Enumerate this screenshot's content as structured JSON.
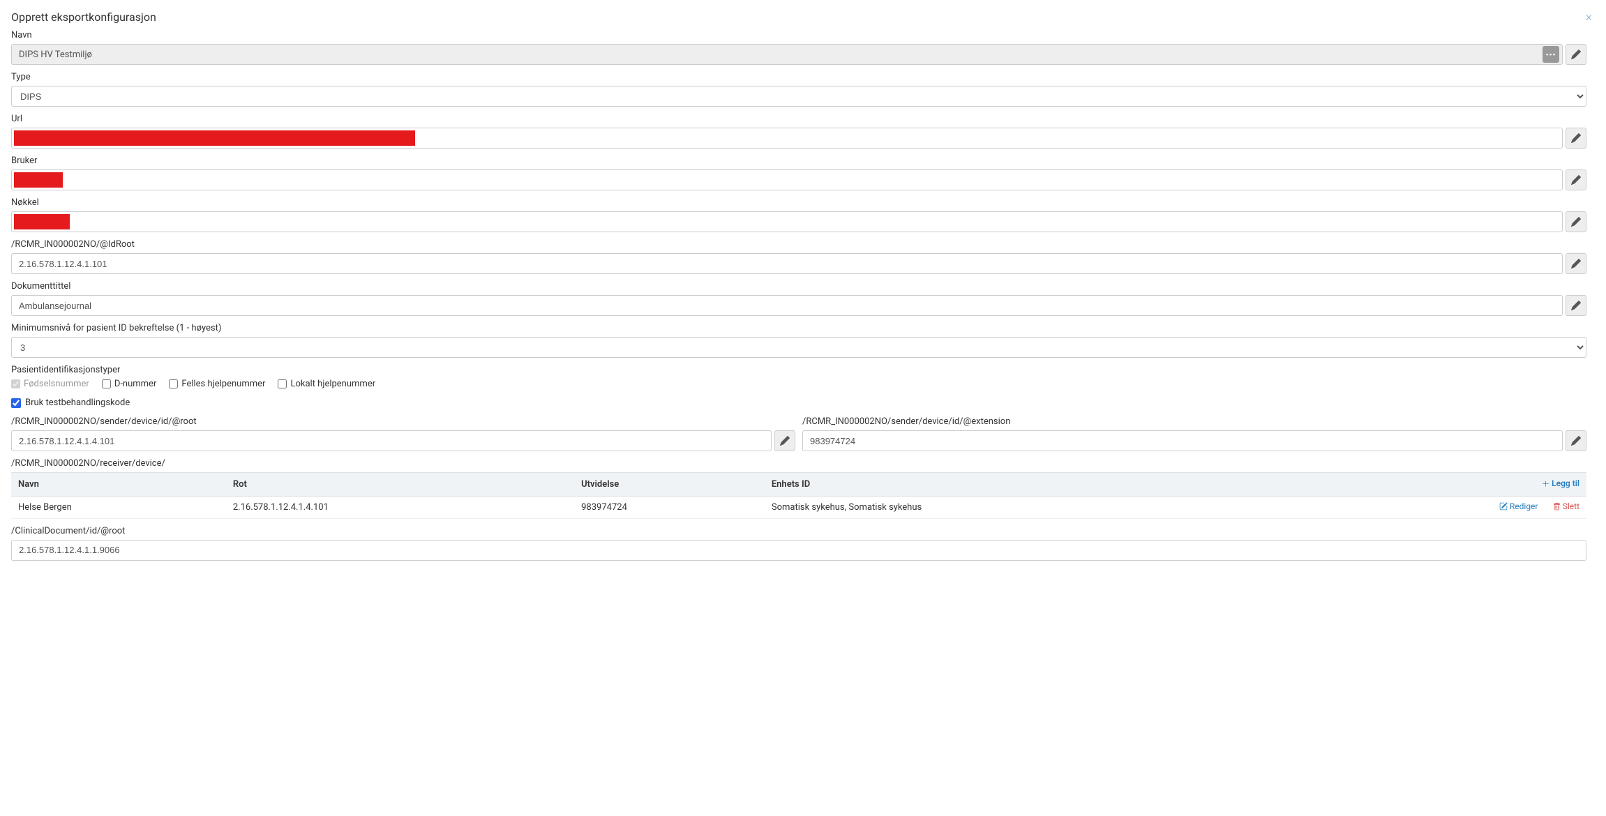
{
  "header": {
    "title": "Opprett eksportkonfigurasjon"
  },
  "fields": {
    "navn": {
      "label": "Navn",
      "value": "DIPS HV Testmiljø"
    },
    "type": {
      "label": "Type",
      "value": "DIPS"
    },
    "url": {
      "label": "Url"
    },
    "bruker": {
      "label": "Bruker"
    },
    "nokkel": {
      "label": "Nøkkel"
    },
    "idRoot": {
      "label": "/RCMR_IN000002NO/@IdRoot",
      "value": "2.16.578.1.12.4.1.101"
    },
    "dokTittel": {
      "label": "Dokumenttittel",
      "value": "Ambulansejournal"
    },
    "minNivaa": {
      "label": "Minimumsnivå for pasient ID bekreftelse (1 - høyest)",
      "value": "3"
    },
    "patientIdTypes": {
      "label": "Pasientidentifikasjonstyper",
      "options": [
        {
          "label": "Fødselsnummer",
          "checked": true,
          "disabled": true
        },
        {
          "label": "D-nummer",
          "checked": false,
          "disabled": false
        },
        {
          "label": "Felles hjelpenummer",
          "checked": false,
          "disabled": false
        },
        {
          "label": "Lokalt hjelpenummer",
          "checked": false,
          "disabled": false
        }
      ]
    },
    "testBehandling": {
      "label": "Bruk testbehandlingskode",
      "checked": true
    },
    "senderRoot": {
      "label": "/RCMR_IN000002NO/sender/device/id/@root",
      "value": "2.16.578.1.12.4.1.4.101"
    },
    "senderExt": {
      "label": "/RCMR_IN000002NO/sender/device/id/@extension",
      "value": "983974724"
    },
    "receiver": {
      "label": "/RCMR_IN000002NO/receiver/device/"
    },
    "clinDocRoot": {
      "label": "/ClinicalDocument/id/@root",
      "value": "2.16.578.1.12.4.1.1.9066"
    }
  },
  "receiverTable": {
    "headers": {
      "navn": "Navn",
      "rot": "Rot",
      "utvidelse": "Utvidelse",
      "enhetsId": "Enhets ID"
    },
    "actions": {
      "add": "Legg til",
      "edit": "Rediger",
      "delete": "Slett"
    },
    "rows": [
      {
        "navn": "Helse Bergen",
        "rot": "2.16.578.1.12.4.1.4.101",
        "utvidelse": "983974724",
        "enhetsId": "Somatisk sykehus, Somatisk sykehus"
      }
    ]
  }
}
